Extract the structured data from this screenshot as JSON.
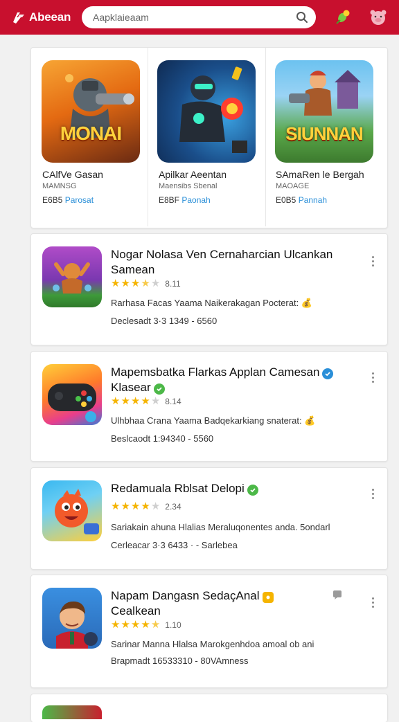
{
  "header": {
    "brand_name": "Abeean",
    "search_placeholder": "Aapklaieaam",
    "colors": {
      "bar": "#c8102e"
    }
  },
  "featured": [
    {
      "thumb_text": "MONAI",
      "title": "CAlfVe Gasan",
      "subtitle": "MAMNSG",
      "code": "E6B5",
      "price": "Parosat"
    },
    {
      "thumb_text": "",
      "title": "Apilkar Aeentan",
      "subtitle": "Maensibs Sbenal",
      "code": "E8BF",
      "price": "Paonah"
    },
    {
      "thumb_text": "SIUNNAN",
      "title": "SAmaRen le Bergah",
      "subtitle": "MAOAGE",
      "code": "E0B5",
      "price": "Pannah"
    }
  ],
  "apps": [
    {
      "title": "Nogar Nolasa Ven Cernaharcian Ulcankan Samean",
      "rating": 3.5,
      "rating_text": "8.11",
      "desc": "Rarhasa Facas Yaama Naikerakagan Pocterat: 💰",
      "meta": "Declesadt  3·3 1349  -  6560",
      "badge": ""
    },
    {
      "title": "Mapemsbatka Flarkas Applan Camesan",
      "title2": "Klasear",
      "rating": 4.0,
      "rating_text": "8.14",
      "desc": "Ulhbhaa Crana Yaama Badqekarkiang snaterat: 💰",
      "meta": "Beslcaodt  1:94340  -  5560",
      "badge": "blue"
    },
    {
      "title": "Redamuala Rblsat Delopi",
      "rating": 4.0,
      "rating_text": "2.34",
      "desc": "Sariakain ahuna Hlalias Meraluqonentes anda. 5ondarl",
      "meta": "Cerleacar  3·3 6433 ·  -  Sarlebea",
      "badge": "green"
    },
    {
      "title": "Napam Dangasn SedaçAnal",
      "title2": "Cealkean",
      "rating": 4.5,
      "rating_text": "1.10",
      "desc": "Sarinar Manna Hlalsa Marokgenhdoa amoal ob ani",
      "meta": "Brapmadt  16533310  -  80VAmness",
      "badge": "yellow"
    }
  ]
}
